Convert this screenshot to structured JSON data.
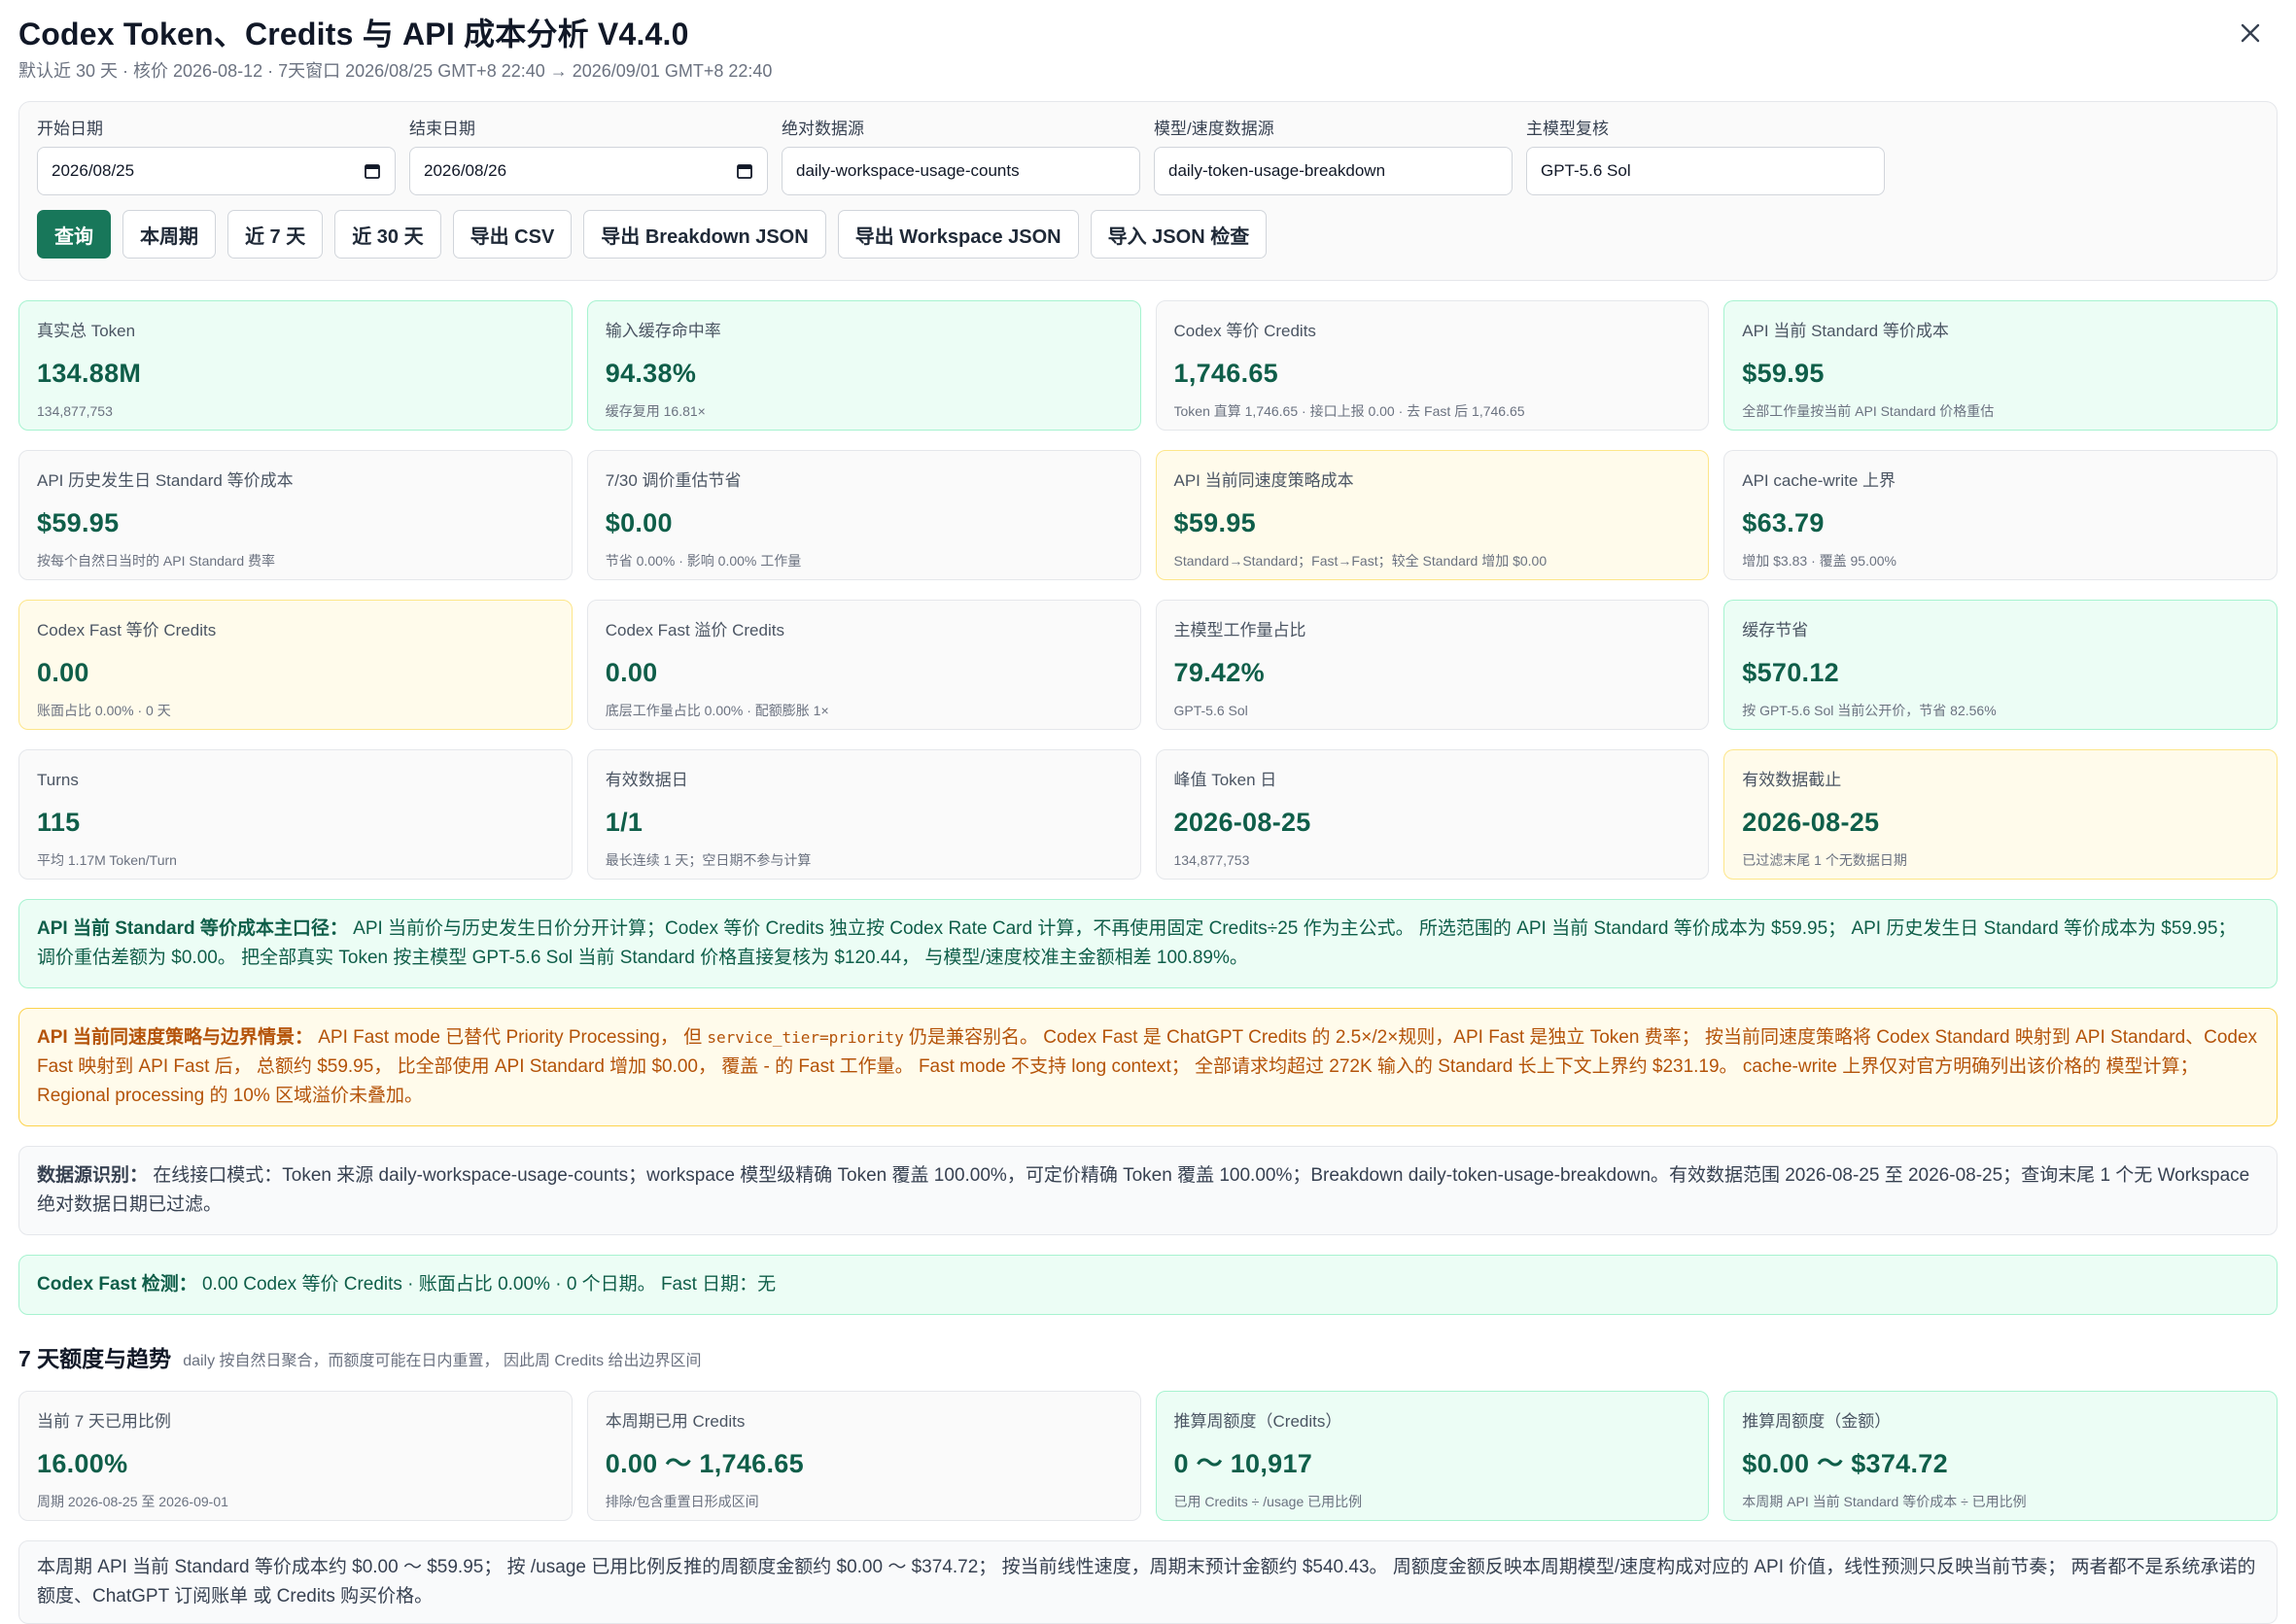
{
  "header": {
    "title": "Codex Token、Credits 与 API 成本分析 V4.4.0",
    "subtitle": "默认近 30 天 · 核价 2026-08-12 · 7天窗口 2026/08/25 GMT+8 22:40 → 2026/09/01 GMT+8 22:40"
  },
  "query": {
    "start_label": "开始日期",
    "start_value": "2026/08/25",
    "end_label": "结束日期",
    "end_value": "2026/08/26",
    "abs_label": "绝对数据源",
    "abs_value": "daily-workspace-usage-counts",
    "model_label": "模型/速度数据源",
    "model_value": "daily-token-usage-breakdown",
    "main_label": "主模型复核",
    "main_value": "GPT-5.6 Sol",
    "buttons": {
      "query": "查询",
      "this_week": "本周期",
      "last7": "近 7 天",
      "last30": "近 30 天",
      "export_csv": "导出 CSV",
      "export_breakdown": "导出 Breakdown JSON",
      "export_workspace": "导出 Workspace JSON",
      "import_json": "导入 JSON 检查"
    }
  },
  "cards": [
    {
      "label": "真实总 Token",
      "value": "134.88M",
      "sub": "134,877,753"
    },
    {
      "label": "输入缓存命中率",
      "value": "94.38%",
      "sub": "缓存复用 16.81×"
    },
    {
      "label": "Codex 等价 Credits",
      "value": "1,746.65",
      "sub": "Token 直算 1,746.65 · 接口上报 0.00 · 去 Fast 后 1,746.65"
    },
    {
      "label": "API 当前 Standard 等价成本",
      "value": "$59.95",
      "sub": "全部工作量按当前 API Standard 价格重估"
    },
    {
      "label": "API 历史发生日 Standard 等价成本",
      "value": "$59.95",
      "sub": "按每个自然日当时的 API Standard 费率"
    },
    {
      "label": "7/30 调价重估节省",
      "value": "$0.00",
      "sub": "节省 0.00% · 影响 0.00% 工作量"
    },
    {
      "label": "API 当前同速度策略成本",
      "value": "$59.95",
      "sub": "Standard→Standard；Fast→Fast；较全 Standard 增加 $0.00"
    },
    {
      "label": "API cache-write 上界",
      "value": "$63.79",
      "sub": "增加 $3.83 · 覆盖 95.00%"
    },
    {
      "label": "Codex Fast 等价 Credits",
      "value": "0.00",
      "sub": "账面占比 0.00% · 0 天"
    },
    {
      "label": "Codex Fast 溢价 Credits",
      "value": "0.00",
      "sub": "底层工作量占比 0.00% · 配额膨胀 1×"
    },
    {
      "label": "主模型工作量占比",
      "value": "79.42%",
      "sub": "GPT-5.6 Sol"
    },
    {
      "label": "缓存节省",
      "value": "$570.12",
      "sub": "按 GPT-5.6 Sol 当前公开价，节省 82.56%"
    },
    {
      "label": "Turns",
      "value": "115",
      "sub": "平均 1.17M Token/Turn"
    },
    {
      "label": "有效数据日",
      "value": "1/1",
      "sub": "最长连续 1 天；空日期不参与计算"
    },
    {
      "label": "峰值 Token 日",
      "value": "2026-08-25",
      "sub": "134,877,753"
    },
    {
      "label": "有效数据截止",
      "value": "2026-08-25",
      "sub": "已过滤末尾 1 个无数据日期"
    }
  ],
  "notices": {
    "standard_title": "API 当前 Standard 等价成本主口径：",
    "standard_text": "API 当前价与历史发生日价分开计算；Codex 等价 Credits 独立按 Codex Rate Card 计算，不再使用固定 Credits÷25 作为主公式。 所选范围的 API 当前 Standard 等价成本为 $59.95； API 历史发生日 Standard 等价成本为 $59.95； 调价重估差额为 $0.00。 把全部真实 Token 按主模型 GPT-5.6 Sol 当前 Standard 价格直接复核为 $120.44， 与模型/速度校准主金额相差 100.89%。",
    "fast_title": "API 当前同速度策略与边界情景：",
    "fast_text_a": "API Fast mode 已替代 Priority Processing， 但",
    "fast_code": "service_tier=priority",
    "fast_text_b": "仍是兼容别名。 Codex Fast 是 ChatGPT Credits 的 2.5×/2×规则，API Fast 是独立 Token 费率； 按当前同速度策略将 Codex Standard 映射到 API Standard、Codex Fast 映射到 API Fast 后， 总额约 $59.95， 比全部使用 API Standard 增加 $0.00， 覆盖 - 的 Fast 工作量。 Fast mode 不支持 long context； 全部请求均超过 272K 输入的 Standard 长上下文上界约 $231.19。 cache-write 上界仅对官方明确列出该价格的 模型计算； Regional processing 的 10% 区域溢价未叠加。",
    "source_title": "数据源识别：",
    "source_text": "在线接口模式：Token 来源 daily-workspace-usage-counts；workspace 模型级精确 Token 覆盖 100.00%，可定价精确 Token 覆盖 100.00%；Breakdown daily-token-usage-breakdown。有效数据范围 2026-08-25 至 2026-08-25；查询末尾 1 个无 Workspace 绝对数据日期已过滤。",
    "detect_title": "Codex Fast 检测：",
    "detect_text": "0.00 Codex 等价 Credits · 账面占比 0.00% · 0 个日期。 Fast 日期：无"
  },
  "section": {
    "title": "7 天额度与趋势",
    "note": "daily 按自然日聚合，而额度可能在日内重置， 因此周 Credits 给出边界区间"
  },
  "cards2": [
    {
      "label": "当前 7 天已用比例",
      "value": "16.00%",
      "sub": "周期 2026-08-25 至 2026-09-01"
    },
    {
      "label": "本周期已用 Credits",
      "value": "0.00 ～ 1,746.65",
      "sub": "排除/包含重置日形成区间"
    },
    {
      "label": "推算周额度（Credits）",
      "value": "0 ～ 10,917",
      "sub": "已用 Credits ÷ /usage 已用比例"
    },
    {
      "label": "推算周额度（金额）",
      "value": "$0.00 ～ $374.72",
      "sub": "本周期 API 当前 Standard 等价成本 ÷ 已用比例"
    }
  ],
  "footer_note": "本周期 API 当前 Standard 等价成本约 $0.00 ～ $59.95； 按 /usage 已用比例反推的周额度金额约 $0.00 ～ $374.72； 按当前线性速度，周期末预计金额约 $540.43。 周额度金额反映本周期模型/速度构成对应的 API 价值，线性预测只反映当前节奏； 两者都不是系统承诺的额度、ChatGPT 订阅账单 或 Credits 购买价格。",
  "colors": {
    "accent": "#18775a",
    "value_green": "#0f5e49",
    "warn": "#b45309"
  }
}
